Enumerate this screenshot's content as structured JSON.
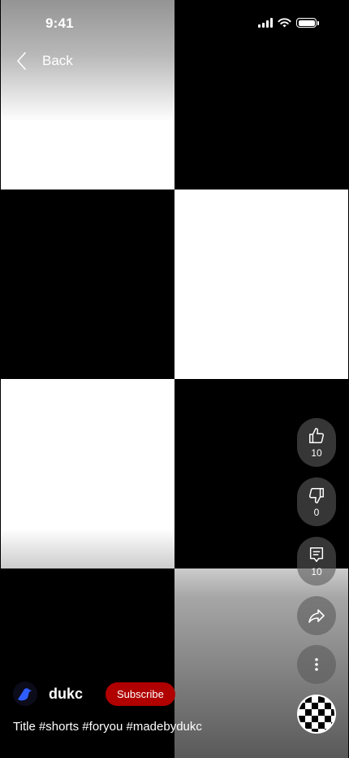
{
  "status_bar": {
    "time": "9:41",
    "icons": [
      "cellular-signal-icon",
      "wifi-icon",
      "battery-icon"
    ]
  },
  "nav": {
    "back_label": "Back",
    "back_icon": "chevron-left-icon"
  },
  "actions": {
    "like": {
      "icon": "thumbs-up-icon",
      "count": "10"
    },
    "dislike": {
      "icon": "thumbs-down-icon",
      "count": "0"
    },
    "comments": {
      "icon": "comment-icon",
      "count": "10"
    },
    "share": {
      "icon": "share-arrow-icon"
    },
    "more": {
      "icon": "more-vertical-icon"
    },
    "sound": {
      "icon": "checkerboard-sound-disc"
    }
  },
  "channel": {
    "name": "dukc",
    "subscribe_label": "Subscribe",
    "avatar_icon": "duck-avatar-icon"
  },
  "video": {
    "title": "Title #shorts #foryou #madebydukc"
  },
  "colors": {
    "subscribe": "#b00000",
    "action_bg": "#5a5a5a",
    "avatar_accent": "#2f5cff"
  }
}
